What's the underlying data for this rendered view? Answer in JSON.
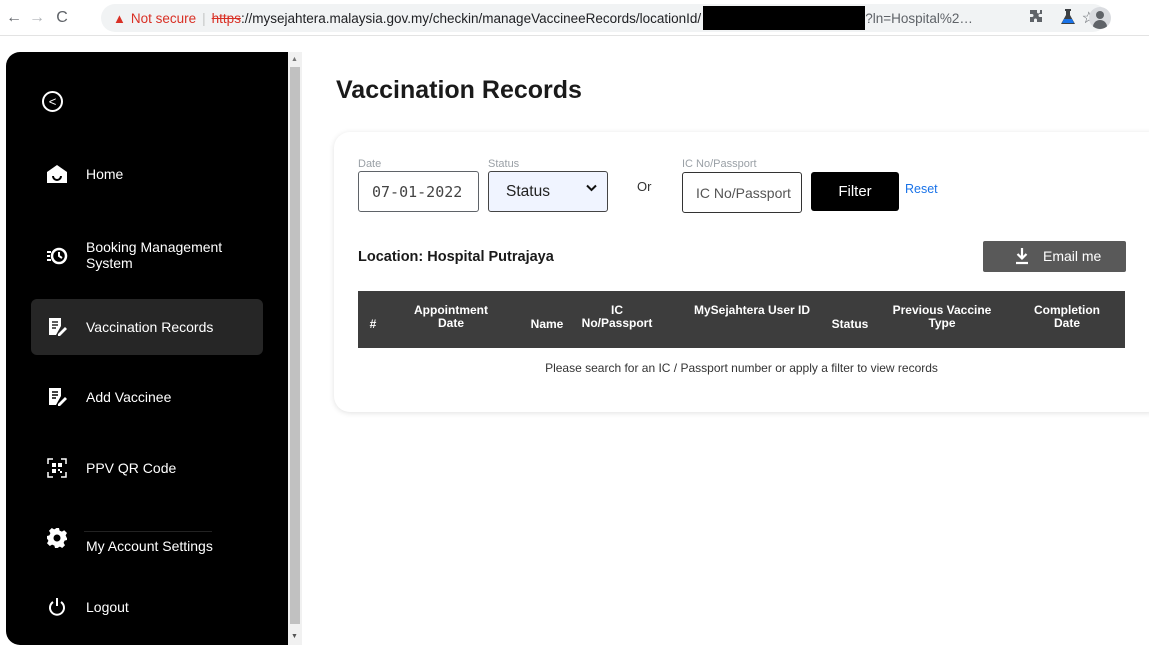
{
  "browser": {
    "not_secure": "Not secure",
    "url_scheme": "https",
    "url_rest": "://mysejahtera.malaysia.gov.my/checkin/manageVaccineeRecords/locationId/",
    "url_tail": "?ln=Hospital%2…"
  },
  "sidebar": {
    "items": [
      {
        "label": "Home",
        "icon": "home-icon"
      },
      {
        "label": "Booking Management System",
        "icon": "booking-icon"
      },
      {
        "label": "Vaccination Records",
        "icon": "records-icon",
        "active": true
      },
      {
        "label": "Add Vaccinee",
        "icon": "add-vaccinee-icon"
      },
      {
        "label": "PPV QR Code",
        "icon": "qr-code-icon"
      },
      {
        "label": "My Account Settings",
        "icon": "gear-icon"
      },
      {
        "label": "Logout",
        "icon": "power-icon"
      }
    ]
  },
  "main": {
    "title": "Vaccination Records",
    "filters": {
      "date_label": "Date",
      "date_value": "07-01-2022",
      "status_label": "Status",
      "status_value": "Status",
      "or_text": "Or",
      "ic_label": "IC No/Passport",
      "ic_placeholder": "IC No/Passport",
      "filter_button": "Filter",
      "reset_link": "Reset"
    },
    "location": "Location: Hospital Putrajaya",
    "email_button": "Email me",
    "table": {
      "columns": [
        "#",
        "Appointment Date",
        "Name",
        "IC No/Passport",
        "MySejahtera User ID",
        "Status",
        "Previous Vaccine Type",
        "Completion Date"
      ],
      "empty_message": "Please search for an IC / Passport number or apply a filter to view records"
    }
  },
  "colors": {
    "sidebar_bg": "#000000",
    "active_item_bg": "#262626",
    "accent_link": "#1a73e8",
    "warning_red": "#d93025",
    "table_header_bg": "#3d3d3d"
  }
}
